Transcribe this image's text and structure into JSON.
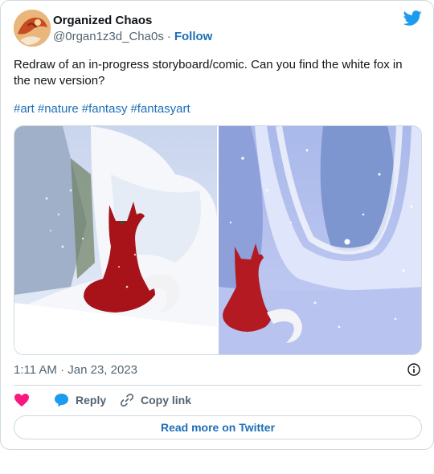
{
  "author": {
    "display_name": "Organized Chaos",
    "handle": "@0rgan1z3d_Cha0s",
    "separator": "·",
    "follow_label": "Follow"
  },
  "tweet": {
    "text": "Redraw of an in-progress storyboard/comic. Can you find the white fox in the new version?",
    "hashtags": [
      "#art",
      "#nature",
      "#fantasy",
      "#fantasyart"
    ],
    "timestamp": "1:11 AM · Jan 23, 2023"
  },
  "actions": {
    "reply_label": "Reply",
    "copy_link_label": "Copy link",
    "read_more_label": "Read more on Twitter"
  },
  "icons": {
    "brand": "twitter-bird-icon",
    "like": "heart-icon",
    "reply": "speech-bubble-icon",
    "copy": "link-icon",
    "info": "info-icon"
  },
  "colors": {
    "twitter_blue": "#1d9bf0",
    "link_blue": "#1d6fb8",
    "like_pink": "#f91880",
    "muted_text": "#536471",
    "border": "#cfd9de"
  }
}
